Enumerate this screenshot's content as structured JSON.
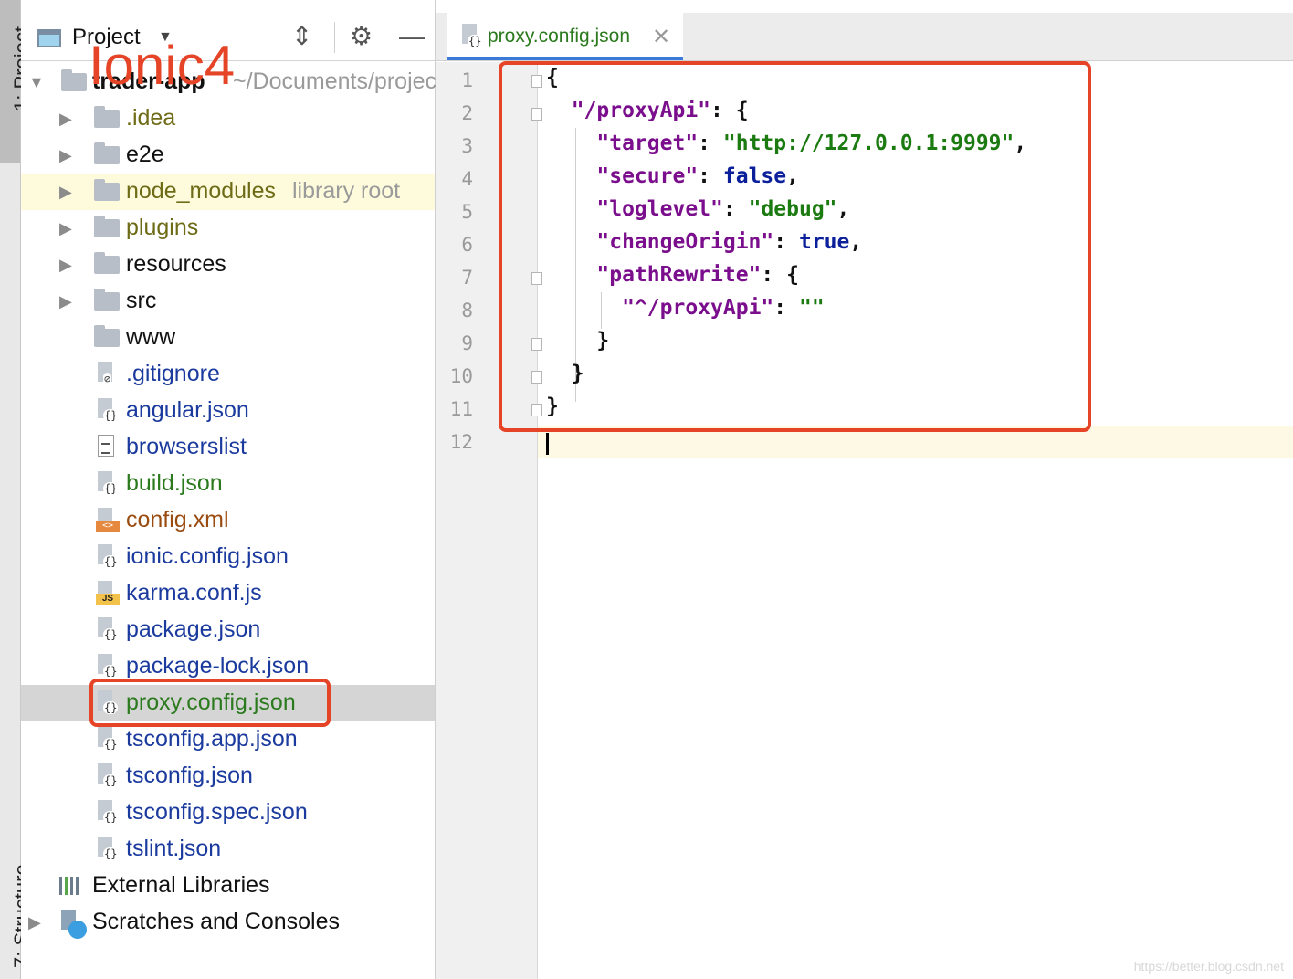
{
  "sidebar_tabs": {
    "project": "1: Project",
    "structure": "7: Structure"
  },
  "project_panel": {
    "title": "Project",
    "header_icons": [
      "collapse-icon",
      "gear-icon",
      "minimize-icon"
    ],
    "overlay_text": "Ionic4",
    "root": {
      "name": "trader-app",
      "path": "~/Documents/projec"
    },
    "items": [
      {
        "label": ".idea",
        "type": "folder",
        "expandable": true,
        "color": "olive"
      },
      {
        "label": "e2e",
        "type": "folder",
        "expandable": true,
        "color": "dark"
      },
      {
        "label": "node_modules",
        "suffix": "library root",
        "type": "folder",
        "expandable": true,
        "color": "olive"
      },
      {
        "label": "plugins",
        "type": "folder",
        "expandable": true,
        "color": "olive"
      },
      {
        "label": "resources",
        "type": "folder",
        "expandable": true,
        "color": "dark"
      },
      {
        "label": "src",
        "type": "folder",
        "expandable": true,
        "color": "dark"
      },
      {
        "label": "www",
        "type": "folder",
        "expandable": false,
        "color": "dark"
      },
      {
        "label": ".gitignore",
        "type": "ignore-file",
        "color": "blue"
      },
      {
        "label": "angular.json",
        "type": "json-file",
        "color": "blue"
      },
      {
        "label": "browserslist",
        "type": "text-file",
        "color": "blue"
      },
      {
        "label": "build.json",
        "type": "json-file",
        "color": "green"
      },
      {
        "label": "config.xml",
        "type": "xml-file",
        "color": "brown"
      },
      {
        "label": "ionic.config.json",
        "type": "json-file",
        "color": "blue"
      },
      {
        "label": "karma.conf.js",
        "type": "js-file",
        "color": "blue"
      },
      {
        "label": "package.json",
        "type": "json-file",
        "color": "blue"
      },
      {
        "label": "package-lock.json",
        "type": "json-file",
        "color": "blue"
      },
      {
        "label": "proxy.config.json",
        "type": "json-file",
        "color": "green",
        "selected": true
      },
      {
        "label": "tsconfig.app.json",
        "type": "json-file",
        "color": "blue"
      },
      {
        "label": "tsconfig.json",
        "type": "json-file",
        "color": "blue"
      },
      {
        "label": "tsconfig.spec.json",
        "type": "json-file",
        "color": "blue"
      },
      {
        "label": "tslint.json",
        "type": "json-file",
        "color": "blue"
      }
    ],
    "external_libraries": "External Libraries",
    "scratches": "Scratches and Consoles"
  },
  "editor": {
    "tab_label": "proxy.config.json",
    "line_numbers": [
      "1",
      "2",
      "3",
      "4",
      "5",
      "6",
      "7",
      "8",
      "9",
      "10",
      "11",
      "12"
    ],
    "code_lines": [
      "{",
      "  \"/proxyApi\": {",
      "    \"target\": \"http://127.0.0.1:9999\",",
      "    \"secure\": false,",
      "    \"loglevel\": \"debug\",",
      "    \"changeOrigin\": true,",
      "    \"pathRewrite\": {",
      "      \"^/proxyApi\": \"\"",
      "    }",
      "  }",
      "}",
      ""
    ],
    "current_line": 12
  },
  "watermark": "https://better.blog.csdn.net",
  "colors": {
    "annotation_red": "#e54427",
    "tab_underline": "#3c7ad8"
  }
}
